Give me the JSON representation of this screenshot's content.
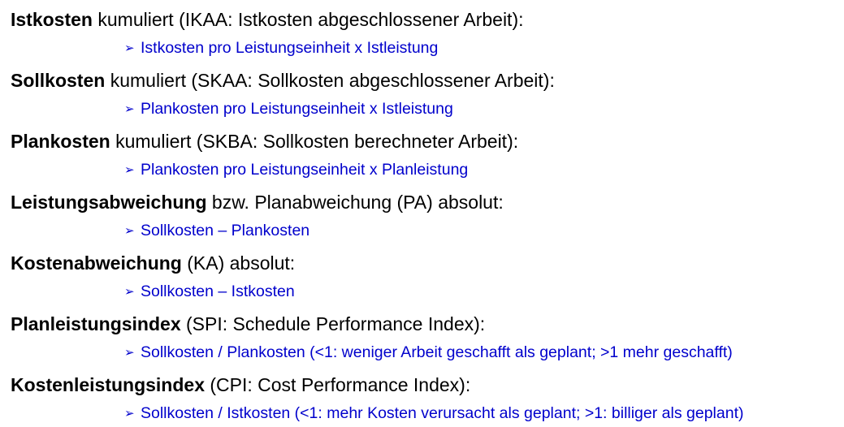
{
  "colors": {
    "text": "#000000",
    "formula": "#0000cc"
  },
  "bullet_icon": "arrowhead-bullet-icon",
  "entries": [
    {
      "term": "Istkosten",
      "description": " kumuliert (IKAA: Istkosten abgeschlossener Arbeit):",
      "formula": "Istkosten pro Leistungseinheit x Istleistung"
    },
    {
      "term": "Sollkosten",
      "description": " kumuliert (SKAA: Sollkosten abgeschlossener Arbeit):",
      "formula": "Plankosten pro Leistungseinheit x Istleistung"
    },
    {
      "term": "Plankosten",
      "description": " kumuliert (SKBA: Sollkosten berechneter Arbeit):",
      "formula": "Plankosten pro Leistungseinheit x Planleistung"
    },
    {
      "term": "Leistungsabweichung",
      "description": " bzw. Planabweichung (PA) absolut:",
      "formula": "Sollkosten – Plankosten"
    },
    {
      "term": "Kostenabweichung",
      "description": " (KA) absolut:",
      "formula": "Sollkosten – Istkosten"
    },
    {
      "term": "Planleistungsindex",
      "description": " (SPI: Schedule Performance Index):",
      "formula": "Sollkosten / Plankosten (<1: weniger Arbeit geschafft als geplant; >1 mehr geschafft)"
    },
    {
      "term": "Kostenleistungsindex",
      "description": " (CPI: Cost Performance Index):",
      "formula": "Sollkosten / Istkosten (<1: mehr Kosten verursacht als geplant; >1: billiger als geplant)"
    }
  ]
}
